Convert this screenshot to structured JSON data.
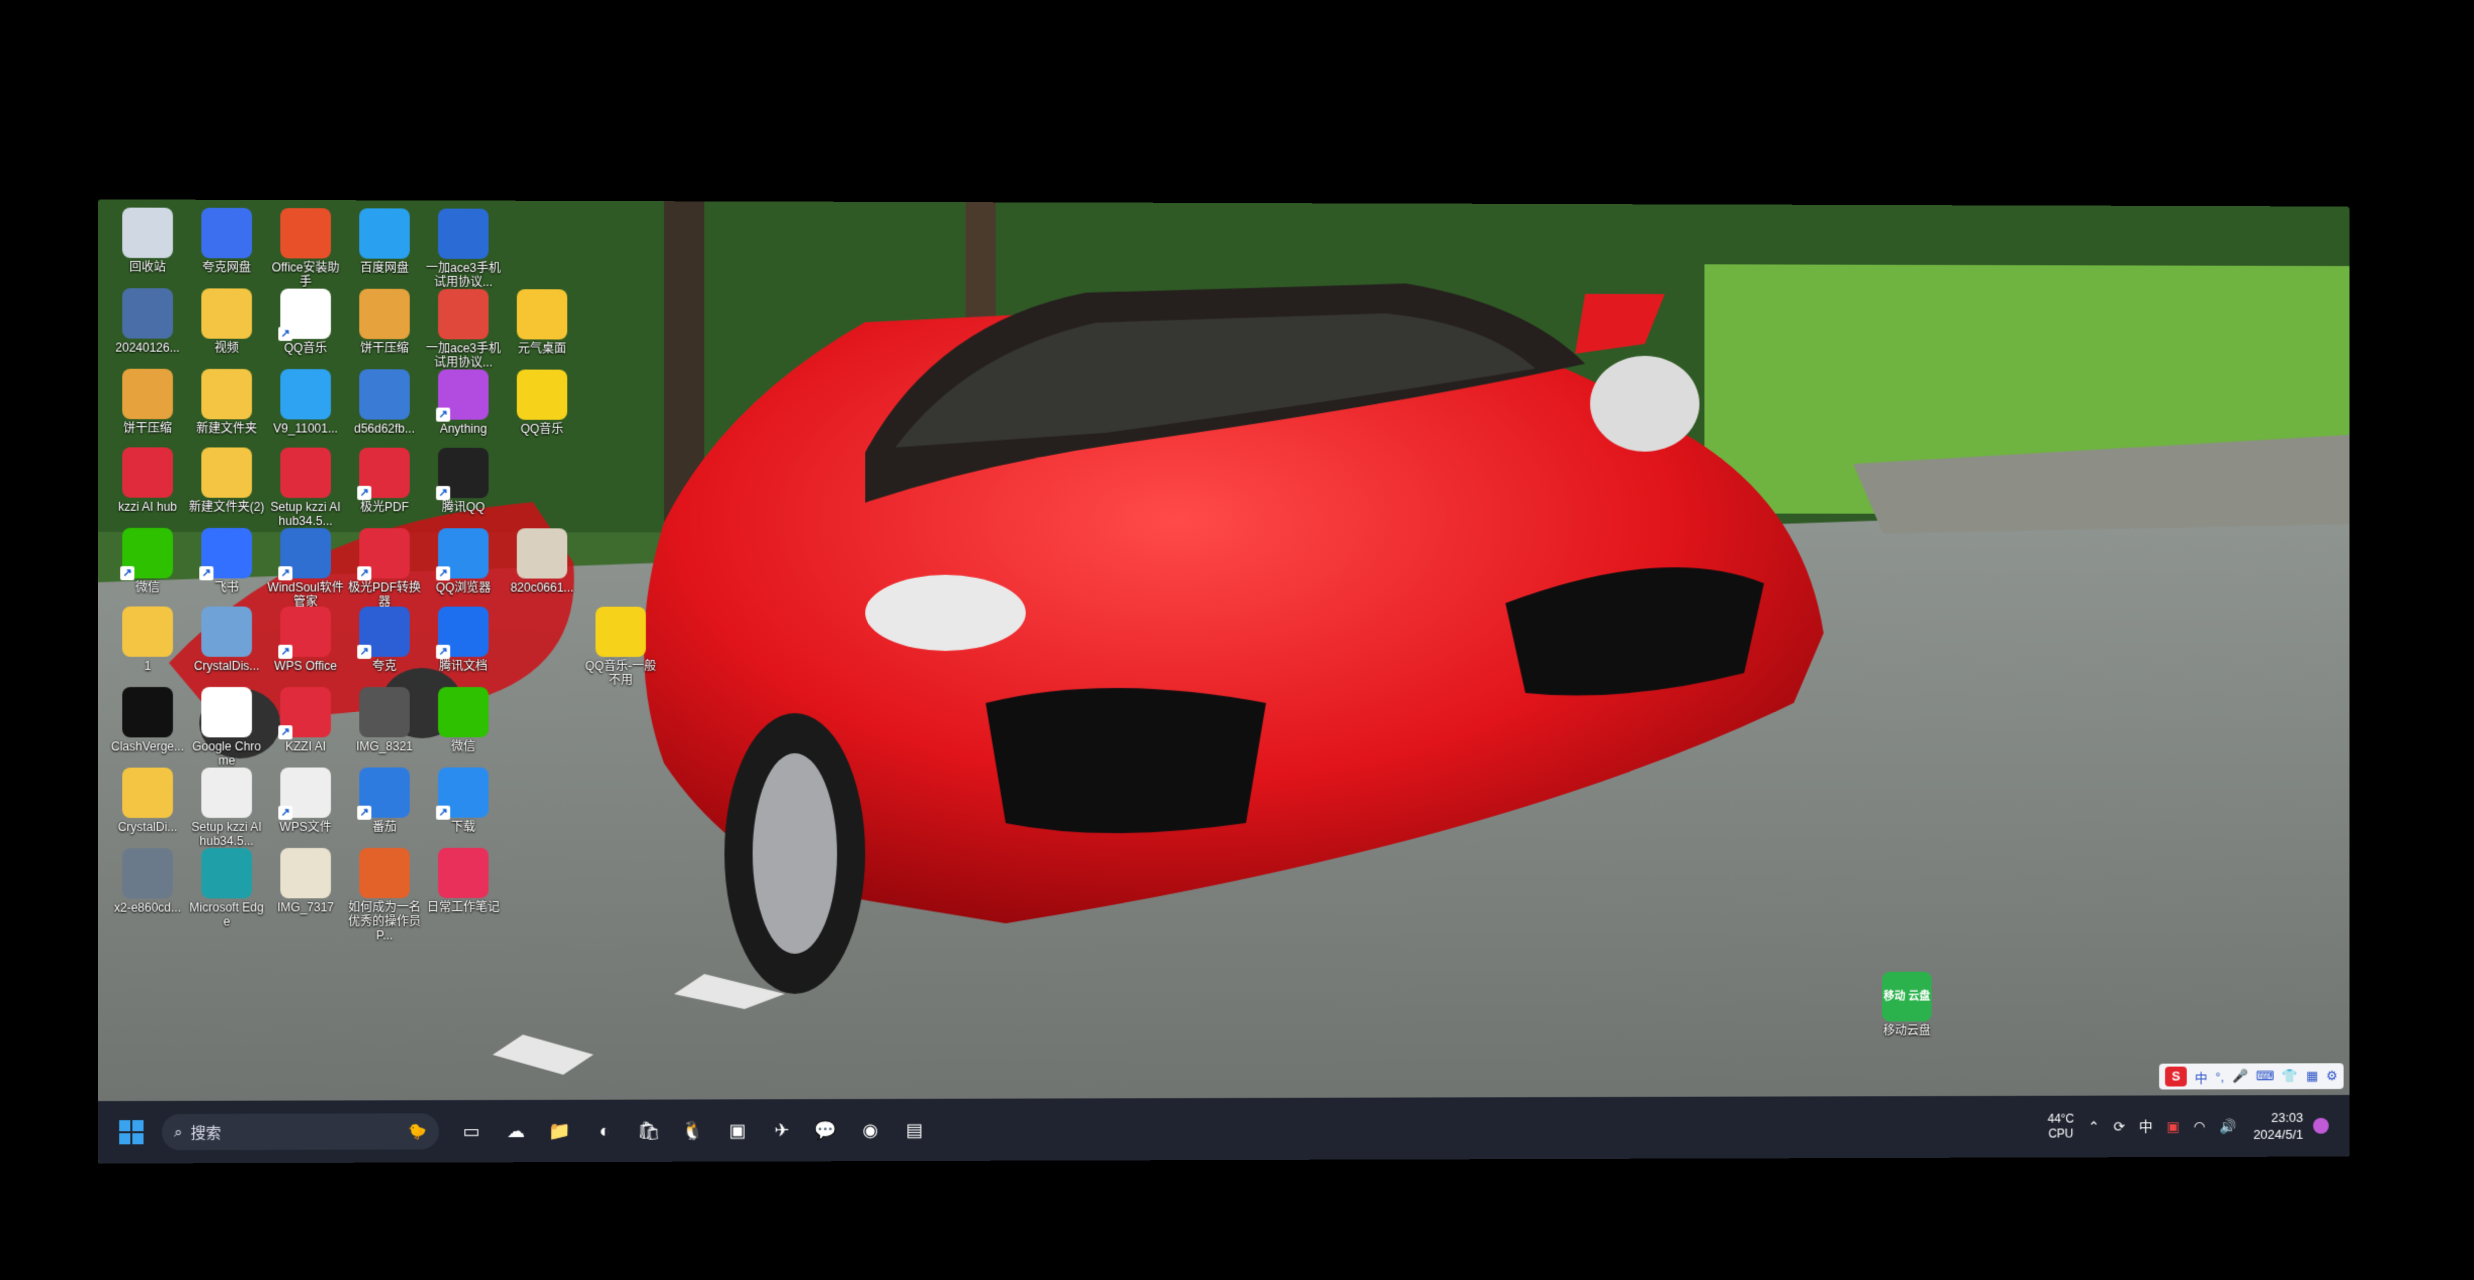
{
  "desktop_icons": [
    {
      "label": "回收站",
      "icon": "recycle-bin-icon",
      "color": "#cfd8e3",
      "shortcut": false,
      "col": 0,
      "row": 0
    },
    {
      "label": "夸克网盘",
      "icon": "quark-cloud-icon",
      "color": "#3b6ff0",
      "shortcut": false,
      "col": 1,
      "row": 0
    },
    {
      "label": "Office安装助手",
      "icon": "office-icon",
      "color": "#e8502a",
      "shortcut": false,
      "col": 2,
      "row": 0
    },
    {
      "label": "百度网盘",
      "icon": "baidu-netdisk-icon",
      "color": "#2aa0f0",
      "shortcut": false,
      "col": 3,
      "row": 0
    },
    {
      "label": "一加ace3手机试用协议...",
      "icon": "word-doc-icon",
      "color": "#2b6bd6",
      "shortcut": false,
      "col": 4,
      "row": 0
    },
    {
      "label": "20240126...",
      "icon": "image-file-icon",
      "color": "#4a6fa8",
      "shortcut": false,
      "col": 0,
      "row": 1
    },
    {
      "label": "视频",
      "icon": "folder-icon",
      "color": "#f4c542",
      "shortcut": false,
      "col": 1,
      "row": 1
    },
    {
      "label": "QQ音乐",
      "icon": "qq-music-icon",
      "color": "#ffffff",
      "shortcut": true,
      "col": 2,
      "row": 1
    },
    {
      "label": "饼干压缩",
      "icon": "zip-archive-icon",
      "color": "#e6a23c",
      "shortcut": false,
      "col": 3,
      "row": 1
    },
    {
      "label": "一加ace3手机试用协议...",
      "icon": "pdf-file-icon",
      "color": "#e0483b",
      "shortcut": false,
      "col": 4,
      "row": 1
    },
    {
      "label": "元气桌面",
      "icon": "yuanqi-desktop-icon",
      "color": "#f6c531",
      "shortcut": false,
      "col": 5,
      "row": 1
    },
    {
      "label": "饼干压缩",
      "icon": "zip-archive-icon",
      "color": "#e6a23c",
      "shortcut": false,
      "col": 0,
      "row": 2
    },
    {
      "label": "新建文件夹",
      "icon": "folder-icon",
      "color": "#f4c542",
      "shortcut": false,
      "col": 1,
      "row": 2
    },
    {
      "label": "V9_11001...",
      "icon": "installer-icon",
      "color": "#2ea3f2",
      "shortcut": false,
      "col": 2,
      "row": 2
    },
    {
      "label": "d56d62fb...",
      "icon": "image-file-icon",
      "color": "#3a7bd5",
      "shortcut": false,
      "col": 3,
      "row": 2
    },
    {
      "label": "Anything",
      "icon": "anything-app-icon",
      "color": "#b24be0",
      "shortcut": true,
      "col": 4,
      "row": 2
    },
    {
      "label": "QQ音乐",
      "icon": "qq-music-icon",
      "color": "#f7d21b",
      "shortcut": false,
      "col": 5,
      "row": 2
    },
    {
      "label": "kzzi AI hub",
      "icon": "kzzi-icon",
      "color": "#e02b3c",
      "shortcut": false,
      "col": 0,
      "row": 3
    },
    {
      "label": "新建文件夹(2)",
      "icon": "folder-icon",
      "color": "#f4c542",
      "shortcut": false,
      "col": 1,
      "row": 3
    },
    {
      "label": "Setup kzzi AI hub34.5...",
      "icon": "kzzi-icon",
      "color": "#e02b3c",
      "shortcut": false,
      "col": 2,
      "row": 3
    },
    {
      "label": "极光PDF",
      "icon": "pdf-reader-icon",
      "color": "#e02b3c",
      "shortcut": true,
      "col": 3,
      "row": 3
    },
    {
      "label": "腾讯QQ",
      "icon": "qq-penguin-icon",
      "color": "#222222",
      "shortcut": true,
      "col": 4,
      "row": 3
    },
    {
      "label": "微信",
      "icon": "wechat-icon",
      "color": "#2dc100",
      "shortcut": true,
      "col": 0,
      "row": 4
    },
    {
      "label": "飞书",
      "icon": "feishu-icon",
      "color": "#3370ff",
      "shortcut": true,
      "col": 1,
      "row": 4
    },
    {
      "label": "WindSoul软件管家",
      "icon": "windsoul-icon",
      "color": "#2f6fd1",
      "shortcut": true,
      "col": 2,
      "row": 4
    },
    {
      "label": "极光PDF转换器",
      "icon": "pdf-reader-icon",
      "color": "#e02b3c",
      "shortcut": true,
      "col": 3,
      "row": 4
    },
    {
      "label": "QQ浏览器",
      "icon": "qq-browser-icon",
      "color": "#2b8cf0",
      "shortcut": true,
      "col": 4,
      "row": 4
    },
    {
      "label": "820c0661...",
      "icon": "image-file-icon",
      "color": "#d9d0c0",
      "shortcut": false,
      "col": 5,
      "row": 4
    },
    {
      "label": "1",
      "icon": "folder-icon",
      "color": "#f4c542",
      "shortcut": false,
      "col": 0,
      "row": 5
    },
    {
      "label": "CrystalDis...",
      "icon": "crystaldisk-icon",
      "color": "#6fa3d8",
      "shortcut": false,
      "col": 1,
      "row": 5
    },
    {
      "label": "WPS Office",
      "icon": "wps-icon",
      "color": "#e02b3c",
      "shortcut": true,
      "col": 2,
      "row": 5
    },
    {
      "label": "夸克",
      "icon": "quark-icon",
      "color": "#2c5fd6",
      "shortcut": true,
      "col": 3,
      "row": 5
    },
    {
      "label": "腾讯文档",
      "icon": "tencent-docs-icon",
      "color": "#1e6ff0",
      "shortcut": true,
      "col": 4,
      "row": 5
    },
    {
      "label": "QQ音乐-一般不用",
      "icon": "qq-music-icon",
      "color": "#f7d21b",
      "shortcut": false,
      "col": 6,
      "row": 5
    },
    {
      "label": "ClashVerge...",
      "icon": "clash-icon",
      "color": "#111111",
      "shortcut": false,
      "col": 0,
      "row": 6
    },
    {
      "label": "Google Chrome",
      "icon": "chrome-icon",
      "color": "#ffffff",
      "shortcut": false,
      "col": 1,
      "row": 6
    },
    {
      "label": "KZZI AI",
      "icon": "kzzi-icon",
      "color": "#e02b3c",
      "shortcut": true,
      "col": 2,
      "row": 6
    },
    {
      "label": "IMG_8321",
      "icon": "image-file-icon",
      "color": "#555555",
      "shortcut": false,
      "col": 3,
      "row": 6
    },
    {
      "label": "微信",
      "icon": "wechat-icon",
      "color": "#2dc100",
      "shortcut": false,
      "col": 4,
      "row": 6
    },
    {
      "label": "CrystalDi...",
      "icon": "folder-icon",
      "color": "#f4c542",
      "shortcut": false,
      "col": 0,
      "row": 7
    },
    {
      "label": "Setup kzzi AI hub34.5...",
      "icon": "generic-file-icon",
      "color": "#eeeeee",
      "shortcut": false,
      "col": 1,
      "row": 7
    },
    {
      "label": "WPS文件",
      "icon": "generic-file-icon",
      "color": "#eeeeee",
      "shortcut": true,
      "col": 2,
      "row": 7
    },
    {
      "label": "番茄",
      "icon": "app-icon",
      "color": "#2e7be0",
      "shortcut": true,
      "col": 3,
      "row": 7
    },
    {
      "label": "下载",
      "icon": "qq-browser-icon",
      "color": "#2b8cf0",
      "shortcut": true,
      "col": 4,
      "row": 7
    },
    {
      "label": "x2-e860cd...",
      "icon": "image-file-icon",
      "color": "#6b7a8a",
      "shortcut": false,
      "col": 0,
      "row": 8
    },
    {
      "label": "Microsoft Edge",
      "icon": "edge-icon",
      "color": "#1fa0a8",
      "shortcut": false,
      "col": 1,
      "row": 8
    },
    {
      "label": "IMG_7317",
      "icon": "image-file-icon",
      "color": "#e8e2cf",
      "shortcut": false,
      "col": 2,
      "row": 8
    },
    {
      "label": "如何成为一名优秀的操作员P...",
      "icon": "ppt-file-icon",
      "color": "#e2622a",
      "shortcut": false,
      "col": 3,
      "row": 8
    },
    {
      "label": "日常工作笔记",
      "icon": "notes-app-icon",
      "color": "#e8305a",
      "shortcut": false,
      "col": 4,
      "row": 8
    }
  ],
  "extra_icon": {
    "label": "移动云盘",
    "badge": "移动 云盘",
    "icon": "mobile-cloud-icon",
    "color": "#2bb24c"
  },
  "taskbar": {
    "search_placeholder": "搜索",
    "pinned": [
      {
        "icon": "task-view-icon",
        "name": "task-view"
      },
      {
        "icon": "weather-icon",
        "name": "widgets"
      },
      {
        "icon": "file-explorer-icon",
        "name": "file-explorer"
      },
      {
        "icon": "edge-icon",
        "name": "edge"
      },
      {
        "icon": "store-icon",
        "name": "store"
      },
      {
        "icon": "qq-penguin-icon",
        "name": "qq"
      },
      {
        "icon": "wechat-work-icon",
        "name": "app-green"
      },
      {
        "icon": "feishu-icon",
        "name": "feishu"
      },
      {
        "icon": "wechat-icon",
        "name": "wechat"
      },
      {
        "icon": "chrome-icon",
        "name": "chrome"
      },
      {
        "icon": "notepad-icon",
        "name": "notepad"
      }
    ],
    "cpu_temp": "44°C",
    "cpu_label": "CPU",
    "ime_lang": "中",
    "time": "23:03",
    "date": "2024/5/1"
  },
  "ime_bar": {
    "logo": "S",
    "lang": "中"
  }
}
